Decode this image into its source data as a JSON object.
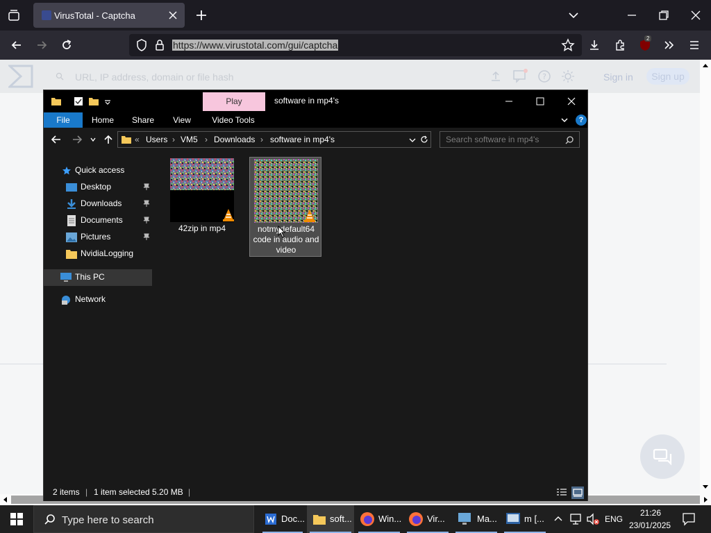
{
  "browser": {
    "tab_title": "VirusTotal - Captcha",
    "url": "https://www.virustotal.com/gui/captcha",
    "extension_badge": "2"
  },
  "vt": {
    "search_placeholder": "URL, IP address, domain or file hash",
    "signin": "Sign in",
    "signup": "Sign up"
  },
  "explorer": {
    "play_tab": "Play",
    "window_title": "software in mp4's",
    "ribbon_tabs": [
      "File",
      "Home",
      "Share",
      "View",
      "Video Tools"
    ],
    "breadcrumb": [
      "Users",
      "VM5",
      "Downloads",
      "software in mp4's"
    ],
    "search_placeholder": "Search software in mp4's",
    "nav": {
      "quick_access": "Quick access",
      "desktop": "Desktop",
      "downloads": "Downloads",
      "documents": "Documents",
      "pictures": "Pictures",
      "nvidialogging": "NvidiaLogging",
      "this_pc": "This PC",
      "network": "Network"
    },
    "files": [
      {
        "name": "42zip in mp4",
        "selected": false
      },
      {
        "name": "notmydefault64 code in audio and video",
        "selected": true
      }
    ],
    "status": {
      "items": "2 items",
      "selected": "1 item selected  5.20 MB"
    }
  },
  "taskbar": {
    "search_placeholder": "Type here to search",
    "apps": [
      {
        "label": "Doc...",
        "icon": "word-icon"
      },
      {
        "label": "soft...",
        "icon": "folder-icon"
      },
      {
        "label": "Win...",
        "icon": "firefox-icon"
      },
      {
        "label": "Vir...",
        "icon": "firefox-icon"
      },
      {
        "label": "Ma...",
        "icon": "computer-icon"
      },
      {
        "label": "m [...",
        "icon": "vm-icon"
      }
    ],
    "language": "ENG",
    "time": "21:26",
    "date": "23/01/2025"
  }
}
